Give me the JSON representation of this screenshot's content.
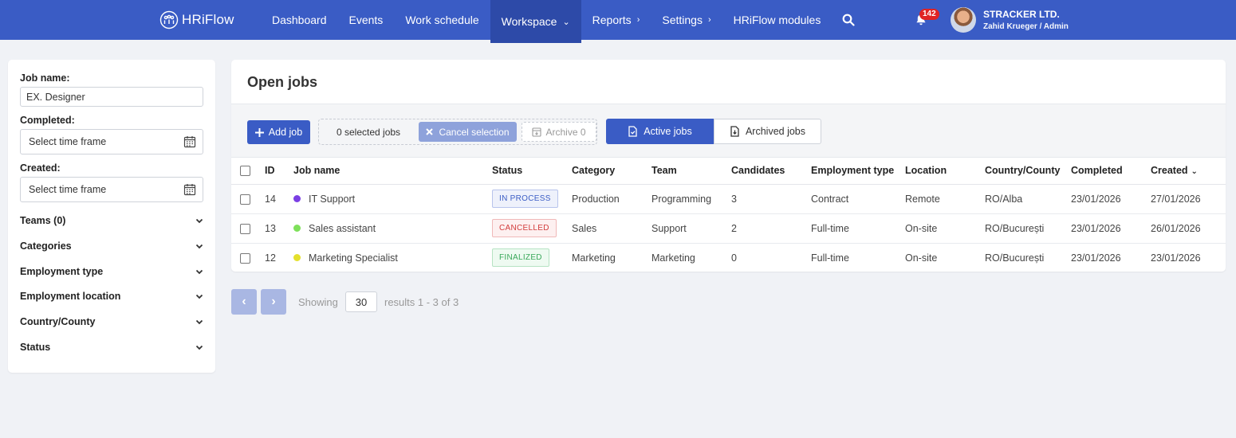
{
  "app": {
    "logo": "HRiFlow"
  },
  "nav": [
    {
      "label": "Dashboard",
      "chevron": ""
    },
    {
      "label": "Events",
      "chevron": ""
    },
    {
      "label": "Work schedule",
      "chevron": ""
    },
    {
      "label": "Workspace",
      "chevron": "⌄",
      "active": true
    },
    {
      "label": "Reports",
      "chevron": "›"
    },
    {
      "label": "Settings",
      "chevron": "›"
    },
    {
      "label": "HRiFlow modules",
      "chevron": ""
    }
  ],
  "header": {
    "notifications": "142",
    "company": "STRACKER LTD.",
    "user": "Zahid Krueger / Admin",
    "accent": "#3a5cc5"
  },
  "filters": {
    "job_name_label": "Job name:",
    "job_name_value": "EX. Designer",
    "completed_label": "Completed:",
    "completed_placeholder": "Select time frame",
    "created_label": "Created:",
    "created_placeholder": "Select time frame",
    "accordions": [
      "Teams (0)",
      "Categories",
      "Employment type",
      "Employment location",
      "Country/County",
      "Status"
    ]
  },
  "main": {
    "title": "Open jobs",
    "add_job": "Add job",
    "selected": "0 selected jobs",
    "cancel_selection": "Cancel selection",
    "archive": "Archive 0",
    "tab_active": "Active jobs",
    "tab_archived": "Archived jobs"
  },
  "table": {
    "columns": [
      "ID",
      "Job name",
      "Status",
      "Category",
      "Team",
      "Candidates",
      "Employment type",
      "Location",
      "Country/County",
      "Completed",
      "Created"
    ],
    "rows": [
      {
        "id": "14",
        "name": "IT Support",
        "dot": "#7b3fe4",
        "status": "IN PROCESS",
        "status_color": "#3a5cc5",
        "status_bg": "#eef1fb",
        "status_border": "#b8c4ec",
        "category": "Production",
        "team": "Programming",
        "candidates": "3",
        "employment": "Contract",
        "location": "Remote",
        "country": "RO/Alba",
        "completed": "23/01/2026",
        "created": "27/01/2026"
      },
      {
        "id": "13",
        "name": "Sales assistant",
        "dot": "#7ee05a",
        "status": "CANCELLED",
        "status_color": "#d23b3b",
        "status_bg": "#fdf0f0",
        "status_border": "#f0b9b9",
        "category": "Sales",
        "team": "Support",
        "candidates": "2",
        "employment": "Full-time",
        "location": "On-site",
        "country": "RO/București",
        "completed": "23/01/2026",
        "created": "26/01/2026"
      },
      {
        "id": "12",
        "name": "Marketing Specialist",
        "dot": "#e4e02c",
        "status": "FINALIZED",
        "status_color": "#3aa85a",
        "status_bg": "#eefaf1",
        "status_border": "#b6e3c3",
        "category": "Marketing",
        "team": "Marketing",
        "candidates": "0",
        "employment": "Full-time",
        "location": "On-site",
        "country": "RO/București",
        "completed": "23/01/2026",
        "created": "23/01/2026"
      }
    ]
  },
  "pagination": {
    "showing": "Showing",
    "per_page": "30",
    "results": "results 1 - 3 of 3"
  }
}
